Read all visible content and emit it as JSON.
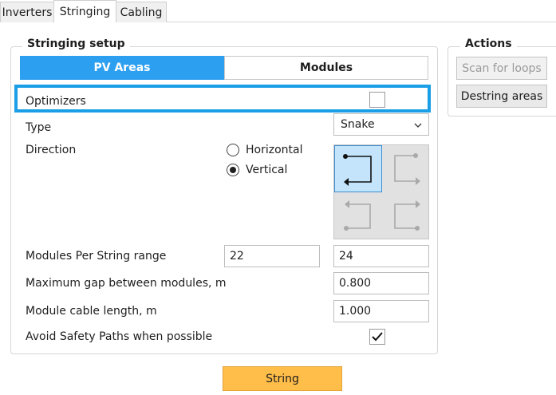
{
  "tabs": [
    {
      "label": "Inverters"
    },
    {
      "label": "Stringing"
    },
    {
      "label": "Cabling"
    }
  ],
  "stringing_setup": {
    "title": "Stringing setup",
    "seg_pv_areas": "PV Areas",
    "seg_modules": "Modules",
    "optimizers_label": "Optimizers",
    "type_label": "Type",
    "type_value": "Snake",
    "direction_label": "Direction",
    "radio_horizontal": "Horizontal",
    "radio_vertical": "Vertical",
    "selected_direction": "Vertical",
    "mps_label": "Modules Per String range",
    "mps_min": "22",
    "mps_max": "24",
    "gap_label": "Maximum gap between modules, m",
    "gap_value": "0.800",
    "cable_label": "Module cable length, m",
    "cable_value": "1.000",
    "avoid_label": "Avoid Safety Paths when possible",
    "avoid_checked": true,
    "optimizers_checked": false
  },
  "actions": {
    "title": "Actions",
    "scan_label": "Scan for loops",
    "destring_label": "Destring areas"
  },
  "string_button": "String",
  "icons": {
    "dropdown": "chevron-down-icon",
    "check": "checkmark-icon"
  },
  "colors": {
    "accent": "#2d9ff0",
    "highlight": "#1a9ee6",
    "primary_button": "#ffbd4a"
  }
}
